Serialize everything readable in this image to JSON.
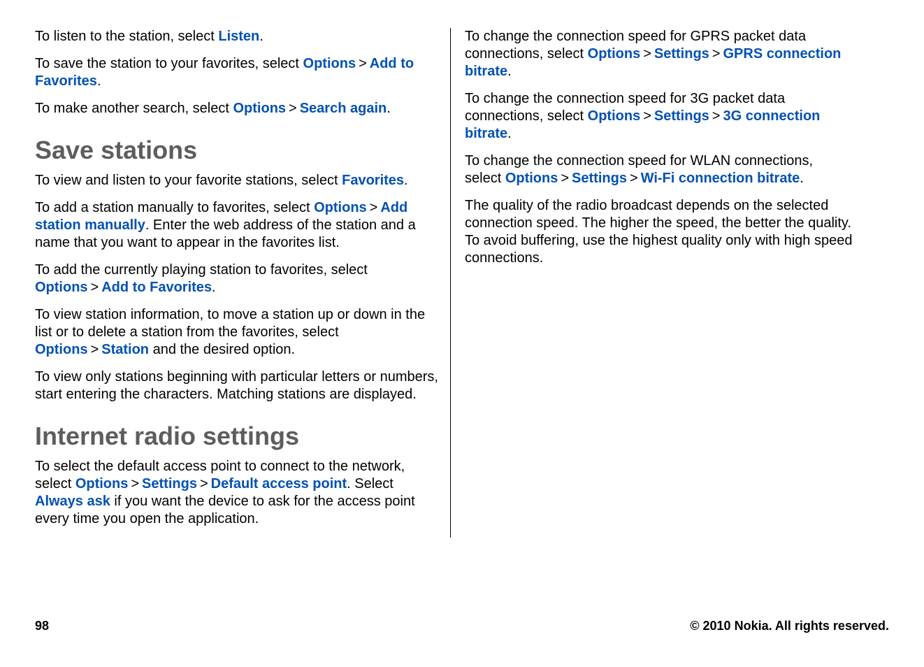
{
  "left": {
    "p1_a": "To listen to the station, select ",
    "p1_kw1": "Listen",
    "p1_b": ".",
    "p2_a": "To save the station to your favorites, select ",
    "p2_kw1": "Options",
    "p2_kw2": "Add to Favorites",
    "p2_b": ".",
    "p3_a": "To make another search, select ",
    "p3_kw1": "Options",
    "p3_kw2": "Search again",
    "p3_b": ".",
    "h1": "Save stations",
    "p4_a": "To view and listen to your favorite stations, select ",
    "p4_kw1": "Favorites",
    "p4_b": ".",
    "p5_a": "To add a station manually to favorites, select ",
    "p5_kw1": "Options",
    "p5_kw2": "Add station manually",
    "p5_b": ". Enter the web address of the station and a name that you want to appear in the favorites list.",
    "p6_a": "To add the currently playing station to favorites, select ",
    "p6_kw1": "Options",
    "p6_kw2": "Add to Favorites",
    "p6_b": ".",
    "p7_a": "To view station information, to move a station up or down in the list or to delete a station from the favorites, select ",
    "p7_kw1": "Options",
    "p7_kw2": "Station",
    "p7_b": " and the desired option.",
    "p8": "To view only stations beginning with particular letters or numbers, start entering the characters. Matching stations are displayed.",
    "h2": "Internet radio settings",
    "p9_a": "To select the default access point to connect to the network, select ",
    "p9_kw1": "Options",
    "p9_kw2": "Settings",
    "p9_kw3": "Default access point",
    "p9_b": ". Select ",
    "p9_kw4": "Always ask",
    "p9_c": " if you want the device to ask for the access point every time you open the application."
  },
  "right": {
    "p1_a": "To change the connection speed for GPRS packet data connections, select ",
    "p1_kw1": "Options",
    "p1_kw2": "Settings",
    "p1_kw3": "GPRS connection bitrate",
    "p1_b": ".",
    "p2_a": "To change the connection speed for 3G packet data connections, select ",
    "p2_kw1": "Options",
    "p2_kw2": "Settings",
    "p2_kw3": "3G connection bitrate",
    "p2_b": ".",
    "p3_a": "To change the connection speed for WLAN connections, select ",
    "p3_kw1": "Options",
    "p3_kw2": "Settings",
    "p3_kw3": "Wi-Fi connection bitrate",
    "p3_b": ".",
    "p4": "The quality of the radio broadcast depends on the selected connection speed. The higher the speed, the better the quality. To avoid buffering, use the highest quality only with high speed connections."
  },
  "footer": {
    "page": "98",
    "copyright": "© 2010 Nokia. All rights reserved."
  },
  "sep": ">"
}
